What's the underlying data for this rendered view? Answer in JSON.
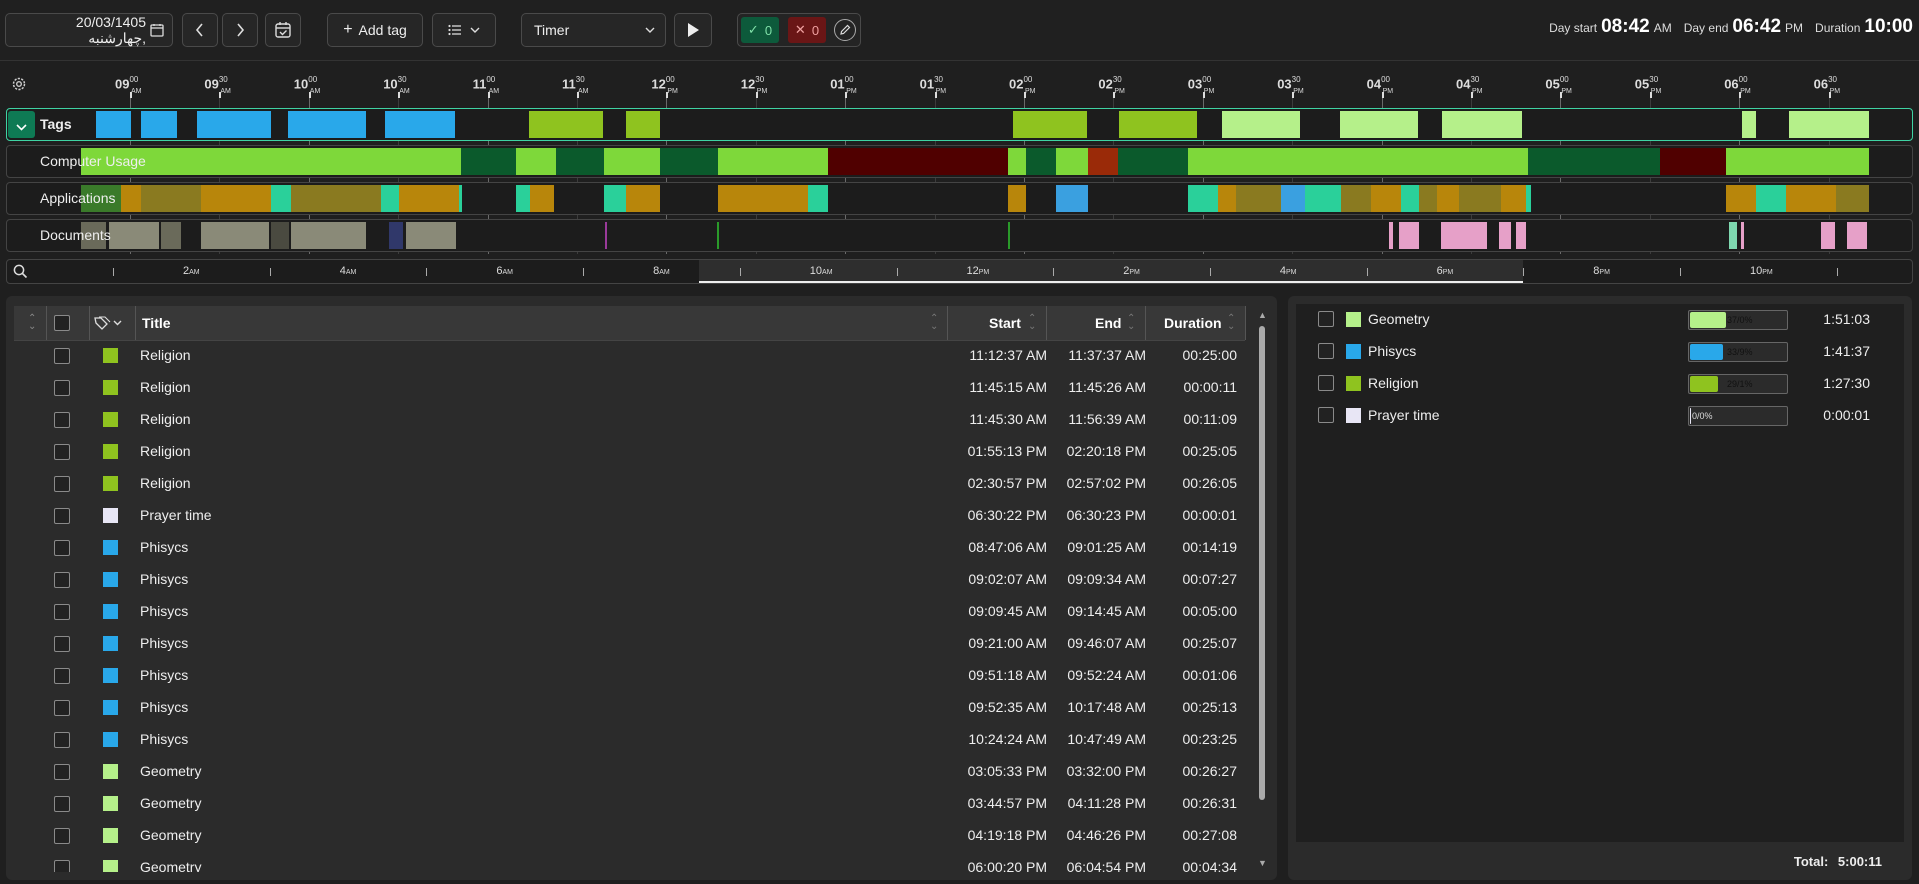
{
  "toolbar": {
    "date": "20/03/1405 ,چهارشنبه",
    "add_tag": "Add tag",
    "timer_select": "Timer",
    "accepted_count": "0",
    "rejected_count": "0",
    "day_start_label": "Day start",
    "day_start_time": "08:42",
    "day_start_ampm": "AM",
    "day_end_label": "Day end",
    "day_end_time": "06:42",
    "day_end_ampm": "PM",
    "duration_label": "Duration",
    "duration_value": "10:00"
  },
  "timeline": {
    "ticks": [
      {
        "h": "09",
        "m": "00",
        "ap": "AM"
      },
      {
        "h": "09",
        "m": "30",
        "ap": "AM"
      },
      {
        "h": "10",
        "m": "00",
        "ap": "AM"
      },
      {
        "h": "10",
        "m": "30",
        "ap": "AM"
      },
      {
        "h": "11",
        "m": "00",
        "ap": "AM"
      },
      {
        "h": "11",
        "m": "30",
        "ap": "AM"
      },
      {
        "h": "12",
        "m": "00",
        "ap": "PM"
      },
      {
        "h": "12",
        "m": "30",
        "ap": "PM"
      },
      {
        "h": "01",
        "m": "00",
        "ap": "PM"
      },
      {
        "h": "01",
        "m": "30",
        "ap": "PM"
      },
      {
        "h": "02",
        "m": "00",
        "ap": "PM"
      },
      {
        "h": "02",
        "m": "30",
        "ap": "PM"
      },
      {
        "h": "03",
        "m": "00",
        "ap": "PM"
      },
      {
        "h": "03",
        "m": "30",
        "ap": "PM"
      },
      {
        "h": "04",
        "m": "00",
        "ap": "PM"
      },
      {
        "h": "04",
        "m": "30",
        "ap": "PM"
      },
      {
        "h": "05",
        "m": "00",
        "ap": "PM"
      },
      {
        "h": "05",
        "m": "30",
        "ap": "PM"
      },
      {
        "h": "06",
        "m": "00",
        "ap": "PM"
      },
      {
        "h": "06",
        "m": "30",
        "ap": "PM"
      }
    ],
    "rows": {
      "tags": "Tags",
      "computer_usage": "Computer Usage",
      "applications": "Applications",
      "documents": "Documents"
    },
    "mini_axis": [
      {
        "n": "2",
        "ap": "AM"
      },
      {
        "n": "4",
        "ap": "AM"
      },
      {
        "n": "6",
        "ap": "AM"
      },
      {
        "n": "8",
        "ap": "AM"
      },
      {
        "n": "10",
        "ap": "AM"
      },
      {
        "n": "12",
        "ap": "PM"
      },
      {
        "n": "2",
        "ap": "PM"
      },
      {
        "n": "4",
        "ap": "PM"
      },
      {
        "n": "6",
        "ap": "PM"
      },
      {
        "n": "8",
        "ap": "PM"
      },
      {
        "n": "10",
        "ap": "PM"
      }
    ]
  },
  "table": {
    "headers": {
      "title": "Title",
      "start": "Start",
      "end": "End",
      "duration": "Duration"
    },
    "rows": [
      {
        "title": "Religion",
        "color": "#8fc31f",
        "start": "11:12:37 AM",
        "end": "11:37:37 AM",
        "duration": "00:25:00"
      },
      {
        "title": "Religion",
        "color": "#8fc31f",
        "start": "11:45:15 AM",
        "end": "11:45:26 AM",
        "duration": "00:00:11"
      },
      {
        "title": "Religion",
        "color": "#8fc31f",
        "start": "11:45:30 AM",
        "end": "11:56:39 AM",
        "duration": "00:11:09"
      },
      {
        "title": "Religion",
        "color": "#8fc31f",
        "start": "01:55:13 PM",
        "end": "02:20:18 PM",
        "duration": "00:25:05"
      },
      {
        "title": "Religion",
        "color": "#8fc31f",
        "start": "02:30:57 PM",
        "end": "02:57:02 PM",
        "duration": "00:26:05"
      },
      {
        "title": "Prayer time",
        "color": "#e8e6f5",
        "start": "06:30:22 PM",
        "end": "06:30:23 PM",
        "duration": "00:00:01"
      },
      {
        "title": "Phisycs",
        "color": "#29a8ea",
        "start": "08:47:06 AM",
        "end": "09:01:25 AM",
        "duration": "00:14:19"
      },
      {
        "title": "Phisycs",
        "color": "#29a8ea",
        "start": "09:02:07 AM",
        "end": "09:09:34 AM",
        "duration": "00:07:27"
      },
      {
        "title": "Phisycs",
        "color": "#29a8ea",
        "start": "09:09:45 AM",
        "end": "09:14:45 AM",
        "duration": "00:05:00"
      },
      {
        "title": "Phisycs",
        "color": "#29a8ea",
        "start": "09:21:00 AM",
        "end": "09:46:07 AM",
        "duration": "00:25:07"
      },
      {
        "title": "Phisycs",
        "color": "#29a8ea",
        "start": "09:51:18 AM",
        "end": "09:52:24 AM",
        "duration": "00:01:06"
      },
      {
        "title": "Phisycs",
        "color": "#29a8ea",
        "start": "09:52:35 AM",
        "end": "10:17:48 AM",
        "duration": "00:25:13"
      },
      {
        "title": "Phisycs",
        "color": "#29a8ea",
        "start": "10:24:24 AM",
        "end": "10:47:49 AM",
        "duration": "00:23:25"
      },
      {
        "title": "Geometry",
        "color": "#b5f08a",
        "start": "03:05:33 PM",
        "end": "03:32:00 PM",
        "duration": "00:26:27"
      },
      {
        "title": "Geometry",
        "color": "#b5f08a",
        "start": "03:44:57 PM",
        "end": "04:11:28 PM",
        "duration": "00:26:31"
      },
      {
        "title": "Geometry",
        "color": "#b5f08a",
        "start": "04:19:18 PM",
        "end": "04:46:26 PM",
        "duration": "00:27:08"
      },
      {
        "title": "Geometry",
        "color": "#b5f08a",
        "start": "06:00:20 PM",
        "end": "06:04:54 PM",
        "duration": "00:04:34"
      }
    ]
  },
  "summary": {
    "items": [
      {
        "name": "Geometry",
        "color": "#b5f08a",
        "pct_text": "37/0%",
        "fraction": 0.37,
        "duration": "1:51:03"
      },
      {
        "name": "Phisycs",
        "color": "#29a8ea",
        "pct_text": "33/9%",
        "fraction": 0.339,
        "duration": "1:41:37"
      },
      {
        "name": "Religion",
        "color": "#8fc31f",
        "pct_text": "29/1%",
        "fraction": 0.291,
        "duration": "1:27:30"
      },
      {
        "name": "Prayer time",
        "color": "#e8e6f5",
        "pct_text": "0/0%",
        "fraction": 0.0,
        "duration": "0:00:01"
      }
    ],
    "total_label": "Total:",
    "total_value": "5:00:11"
  }
}
